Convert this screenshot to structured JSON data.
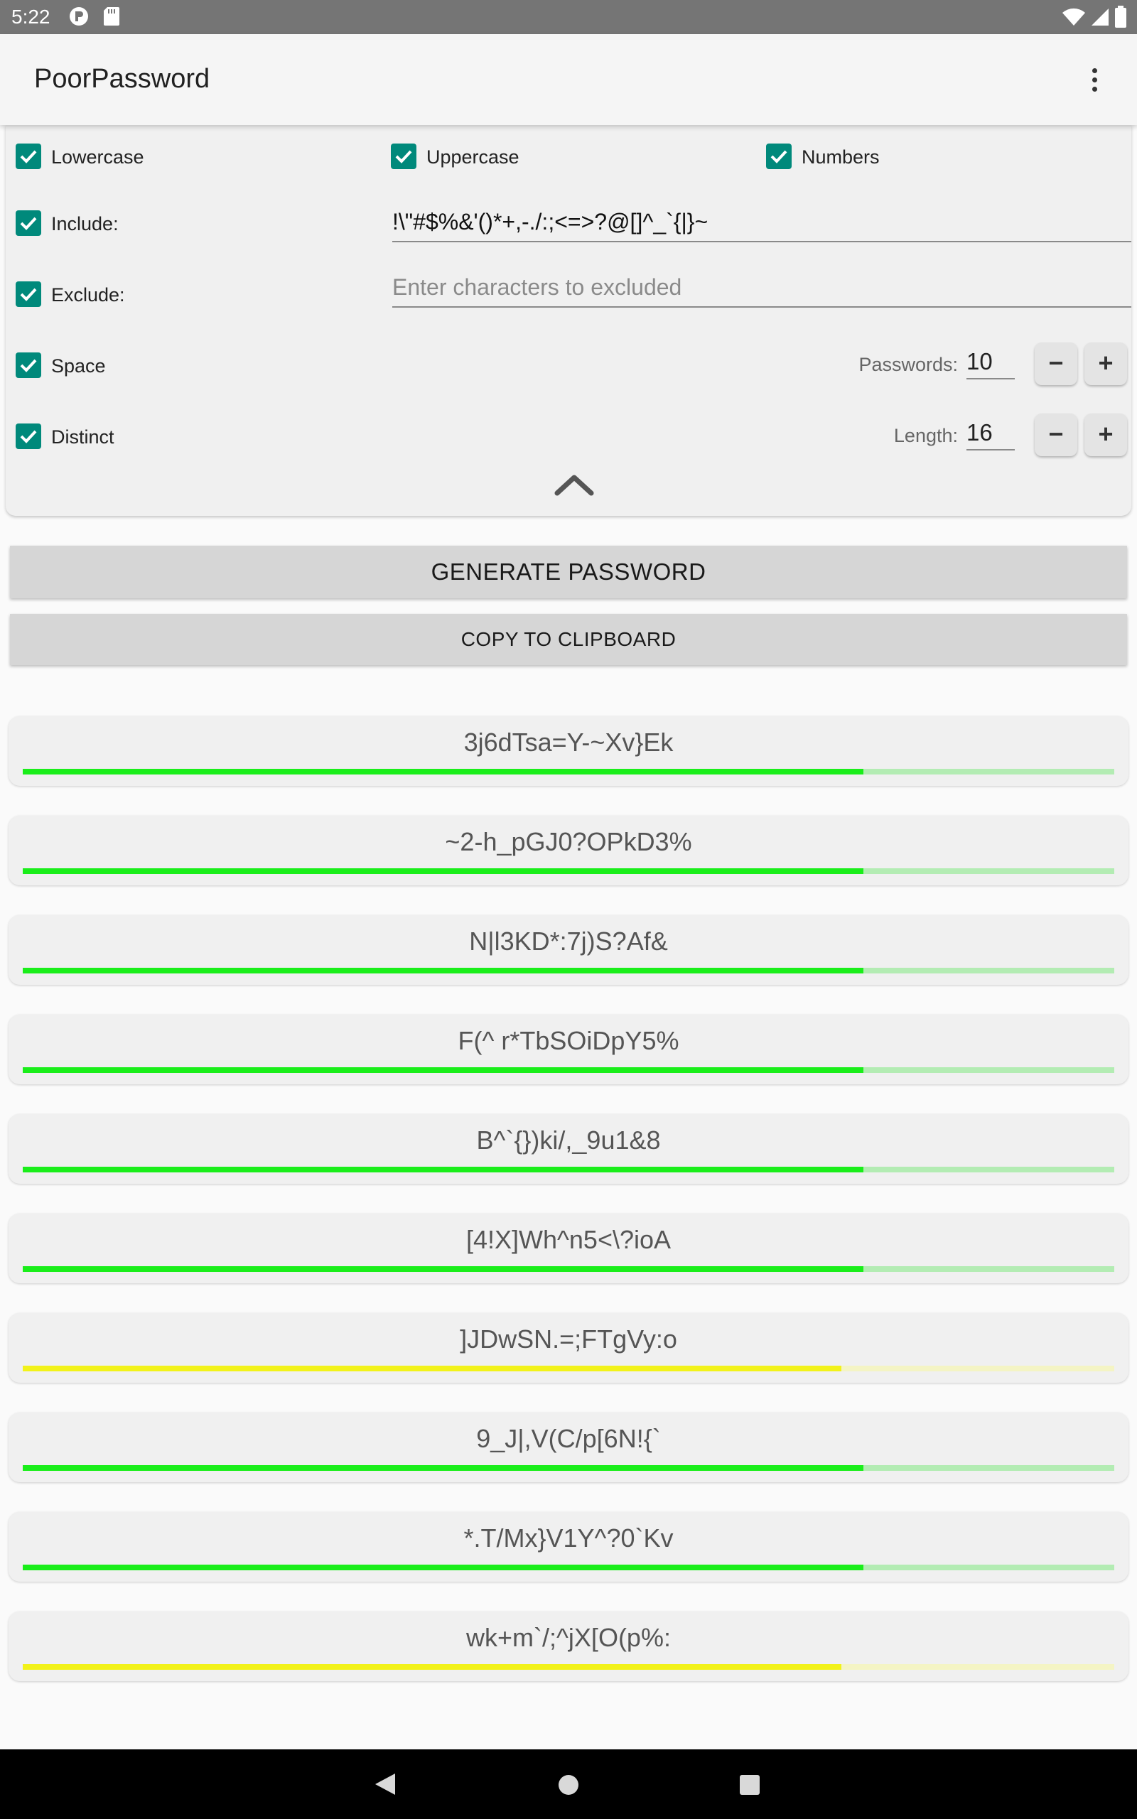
{
  "status_bar": {
    "time": "5:22"
  },
  "app_bar": {
    "title": "PoorPassword"
  },
  "options": {
    "lowercase": {
      "label": "Lowercase",
      "checked": true
    },
    "uppercase": {
      "label": "Uppercase",
      "checked": true
    },
    "numbers": {
      "label": "Numbers",
      "checked": true
    },
    "include": {
      "label": "Include:",
      "checked": true,
      "value": "!\\\"#$%&'()*+,-./:;<=>?@[]^_`{|}~"
    },
    "exclude": {
      "label": "Exclude:",
      "checked": true,
      "value": "",
      "placeholder": "Enter characters to excluded"
    },
    "space": {
      "label": "Space",
      "checked": true
    },
    "distinct": {
      "label": "Distinct",
      "checked": true
    },
    "passwords": {
      "label": "Passwords:",
      "value": "10",
      "minus": "−",
      "plus": "+"
    },
    "length": {
      "label": "Length:",
      "value": "16",
      "minus": "−",
      "plus": "+"
    }
  },
  "buttons": {
    "generate": "GENERATE PASSWORD",
    "copy": "COPY TO CLIPBOARD"
  },
  "colors": {
    "accent": "#00897b",
    "strong": "#1aee1a",
    "strong_track": "#b3ecb3",
    "medium": "#f2f21a",
    "medium_track": "#f4f4c4"
  },
  "passwords": [
    {
      "text": "3j6dTsa=Y-~Xv}Ek",
      "strength": "strong",
      "level": 0.77
    },
    {
      "text": "~2-h_pGJ0?OPkD3%",
      "strength": "strong",
      "level": 0.77
    },
    {
      "text": "N|l3KD*:7j)S?Af&",
      "strength": "strong",
      "level": 0.77
    },
    {
      "text": "F(^ r*TbSOiDpY5%",
      "strength": "strong",
      "level": 0.77
    },
    {
      "text": "B^`{})ki/,_9u1&8",
      "strength": "strong",
      "level": 0.77
    },
    {
      "text": "[4!X]Wh^n5<\\?ioA",
      "strength": "strong",
      "level": 0.77
    },
    {
      "text": "]JDwSN.=;FTgVy:o",
      "strength": "medium",
      "level": 0.75
    },
    {
      "text": "9_J|,V(C/p[6N!{`",
      "strength": "strong",
      "level": 0.77
    },
    {
      "text": "*.T/Mx}V1Y^?0`Kv",
      "strength": "strong",
      "level": 0.77
    },
    {
      "text": "wk+m`/;^jX[O(p%:",
      "strength": "medium",
      "level": 0.75
    }
  ]
}
